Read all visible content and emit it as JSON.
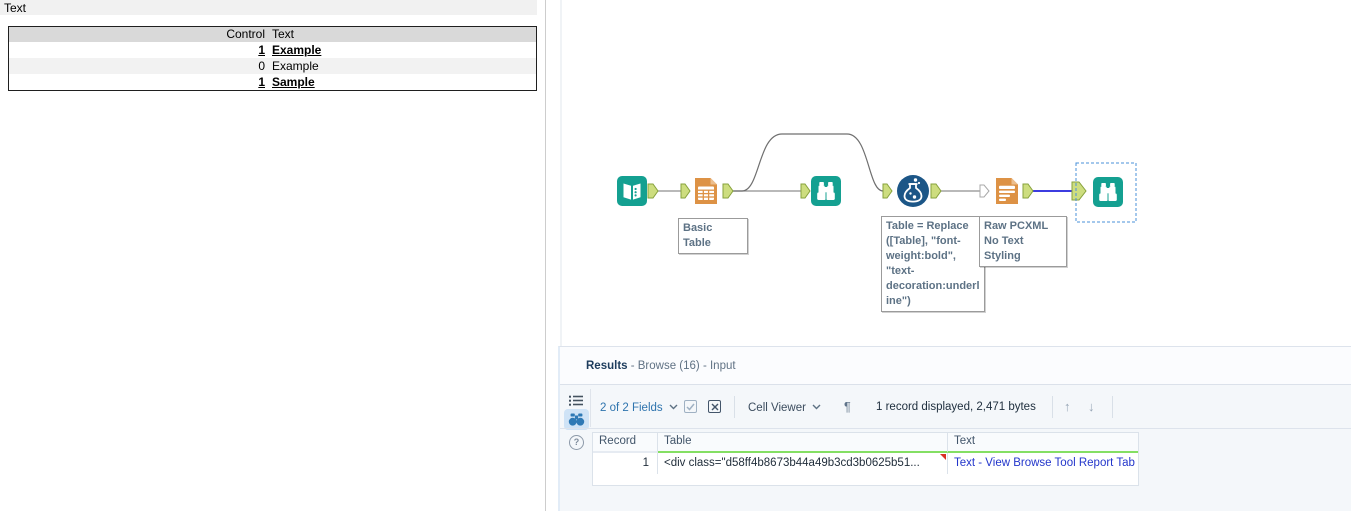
{
  "report": {
    "title": "Text",
    "table": {
      "col1_header": "Control",
      "col2_header": "Text",
      "rows": [
        {
          "control": "1",
          "text": "Example",
          "emphasis": true
        },
        {
          "control": "0",
          "text": "Example",
          "emphasis": false
        },
        {
          "control": "1",
          "text": "Sample",
          "emphasis": true
        }
      ]
    }
  },
  "canvas": {
    "annotations": {
      "basic_table": "Basic Table",
      "formula": "Table = Replace ([Table], \"font-weight:bold\", \"text-decoration:underline\")",
      "raw_pcxml": "Raw PCXML\nNo Text Styling"
    },
    "colors": {
      "tool_teal": "#14A091",
      "tool_orange": "#DD9245",
      "tool_blue": "#1C5687",
      "anchor_green": "#cddd7f",
      "wire_gray": "#8f8f8f",
      "wire_selected_blue": "#3c3ce0",
      "selection_dash_blue": "#4a90d9"
    }
  },
  "results": {
    "title": "Results",
    "subtitle": " - Browse (16) - Input",
    "toolbar": {
      "fields": "2 of 2 Fields",
      "cell_viewer": "Cell Viewer",
      "summary": "1 record displayed, 2,471 bytes"
    },
    "icons": {
      "pilcrow": "¶",
      "up_arrow": "↑",
      "down_arrow": "↓",
      "help": "?"
    },
    "grid": {
      "headers": [
        "Record",
        "Table",
        "Text"
      ],
      "row": {
        "record": "1",
        "table": "<div class=\"d58ff4b8673b44a49b3cd3b0625b51...",
        "text": "Text - View Browse Tool Report Tab"
      }
    },
    "accent_green": "#84df63",
    "link_blue": "#2336cb"
  }
}
